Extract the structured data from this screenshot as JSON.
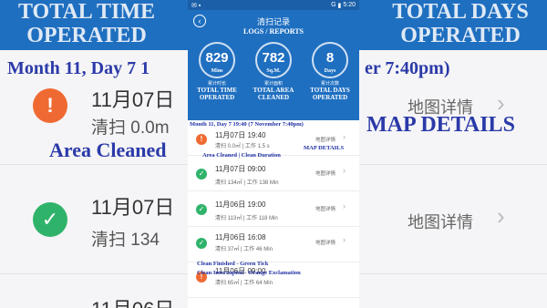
{
  "status_bar": {
    "time": "5:20",
    "battery": "",
    "signal": "G"
  },
  "header": {
    "title": "清扫记录",
    "subtitle": "LOGS / REPORTS",
    "back_glyph": "‹",
    "stats": [
      {
        "value": "829",
        "unit": "Mins",
        "unit_small": "分钟",
        "label_cn": "累计时长",
        "label_en_1": "TOTAL TIME",
        "label_en_2": "OPERATED"
      },
      {
        "value": "782",
        "unit": "Sq.M.",
        "unit_small": "平方米",
        "label_cn": "累计面积",
        "label_en_1": "TOTAL AREA",
        "label_en_2": "CLEANED"
      },
      {
        "value": "8",
        "unit": "Days",
        "unit_small": "次",
        "label_cn": "累计次数",
        "label_en_1": "TOTAL DAYS",
        "label_en_2": "OPERATED"
      }
    ]
  },
  "annotations": {
    "month_day": "Month 11, Day 7 19:40 (7 November 7:40pm)",
    "map_details": "MAP DETAILS",
    "area_duration": "Area Cleaned | Clean Duration",
    "finished": "Clean Finished - Green Tick",
    "interrupted": "Clean Interrupted - Orange Exclamation"
  },
  "records": [
    {
      "status": "interrupted",
      "icon": "!",
      "date": "11月07日",
      "time": "19:40",
      "detail": "清扫 0.0㎡ | 工作 1.5 s",
      "map": "地图详情"
    },
    {
      "status": "finished",
      "icon": "✓",
      "date": "11月07日",
      "time": "09:00",
      "detail": "清扫 134㎡ | 工作 138 Min",
      "map": "地图详情"
    },
    {
      "status": "finished",
      "icon": "✓",
      "date": "11月06日",
      "time": "19:00",
      "detail": "清扫 113㎡ | 工作 118 Min",
      "map": "地图详情"
    },
    {
      "status": "finished",
      "icon": "✓",
      "date": "11月06日",
      "time": "16:08",
      "detail": "清扫 37㎡ | 工作 46 Min",
      "map": "地图详情"
    },
    {
      "status": "interrupted",
      "icon": "!",
      "date": "11月06日",
      "time": "09:00",
      "detail": "清扫 65㎡ | 工作 64 Min",
      "map": "地图详情"
    }
  ],
  "background": {
    "left_title_1": "TOTAL TIME",
    "left_title_2": "OPERATED",
    "right_title_1": "TOTAL DAYS",
    "right_title_2": "OPERATED",
    "annot_top": "Month 11, Day 7 1",
    "annot_top_right": "er 7:40pm)",
    "annot_map": "MAP DETAILS",
    "annot_area": "Area Cleaned",
    "row1_date": "11月07日",
    "row1_sub": "清扫 0.0m",
    "row2_date": "11月07日",
    "row2_sub": "清扫 134",
    "row3_date": "11月06日",
    "map_label": "地图详情"
  },
  "colors": {
    "header_blue": "#1f6fc0",
    "orange": "#ef6a32",
    "green": "#2fb36a",
    "annotation_blue": "#1e2fa3"
  }
}
